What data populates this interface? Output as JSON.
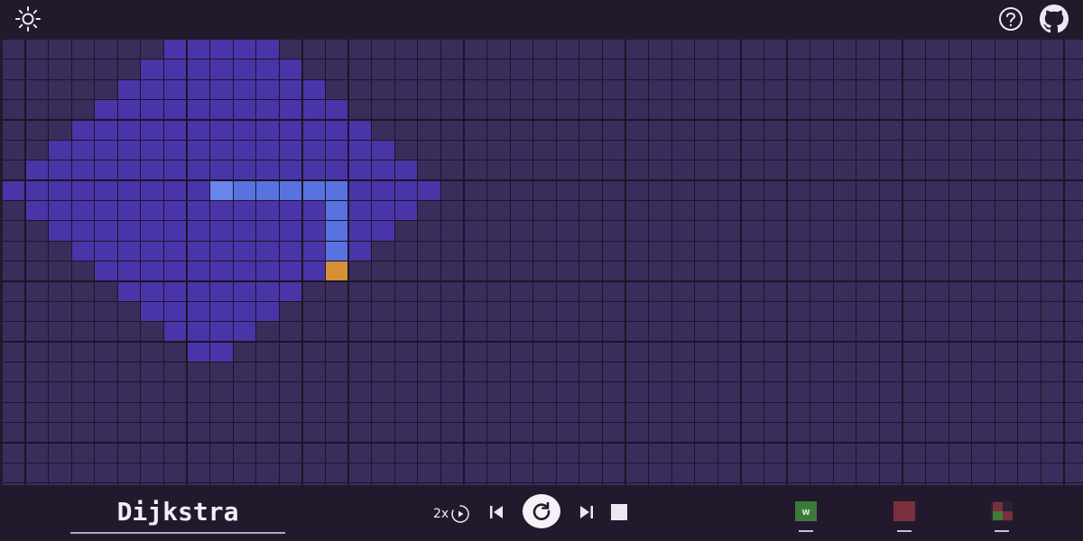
{
  "header": {
    "theme_toggle_icon": "sun-icon",
    "help_icon": "help-circle-icon",
    "github_icon": "github-icon"
  },
  "grid": {
    "rows": 23,
    "cols": 47,
    "visited_ranges": [
      [
        0,
        7,
        11
      ],
      [
        1,
        6,
        12
      ],
      [
        2,
        5,
        13
      ],
      [
        3,
        4,
        14
      ],
      [
        4,
        3,
        15
      ],
      [
        5,
        2,
        16
      ],
      [
        6,
        1,
        17
      ],
      [
        7,
        0,
        18
      ],
      [
        8,
        1,
        17
      ],
      [
        9,
        2,
        16
      ],
      [
        10,
        3,
        15
      ],
      [
        11,
        4,
        14
      ],
      [
        12,
        5,
        12
      ],
      [
        13,
        6,
        11
      ],
      [
        14,
        7,
        10
      ],
      [
        15,
        8,
        9
      ]
    ],
    "path_cells": [
      [
        7,
        9
      ],
      [
        7,
        10
      ],
      [
        7,
        11
      ],
      [
        7,
        12
      ],
      [
        7,
        13
      ],
      [
        7,
        14
      ],
      [
        8,
        14
      ],
      [
        9,
        14
      ],
      [
        10,
        14
      ]
    ],
    "start_cell": [
      7,
      9
    ],
    "target_cell": [
      11,
      14
    ]
  },
  "colors": {
    "empty": "#3a2d5b",
    "visited": "#4a35a8",
    "path": "#5872e0",
    "target": "#d69038"
  },
  "controls": {
    "algorithm": "Dijkstra",
    "speed_label": "2x",
    "icons": [
      "play-circle-icon",
      "skip-back-icon",
      "replay-icon",
      "skip-forward-icon",
      "stop-icon"
    ]
  },
  "tools": {
    "weight_label": "W",
    "weight_color": "#3b7a3b",
    "wall_color": "#7a2f3d",
    "maze_colors": [
      "#7a2f3d",
      "#2a2236",
      "#3b7a3b",
      "#7a2f3d"
    ]
  }
}
